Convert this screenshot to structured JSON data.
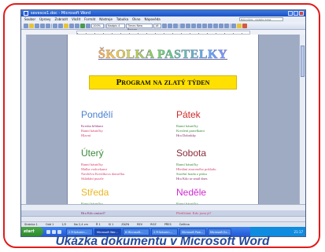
{
  "window": {
    "title": "sevesce1.doc - Microsoft Word"
  },
  "menubar": {
    "items": [
      "Soubor",
      "Úpravy",
      "Zobrazit",
      "Vložit",
      "Formát",
      "Nástroje",
      "Tabulka",
      "Okno",
      "Nápověda"
    ],
    "help_placeholder": "Nápověda - zadejte dotaz"
  },
  "toolbar": {
    "zoom": "100%",
    "style": "Nadpis 4",
    "font": "Times New Roman",
    "size": "16"
  },
  "document": {
    "title": "ŠKOLKA PASTELKY",
    "banner": "Program na zlatý týden",
    "days": [
      {
        "name": "Pondělí",
        "color": "#4a7fd1",
        "items": [
          {
            "text": "Kresba křídami",
            "color": "#8a2d6e"
          },
          {
            "text": "Ranní básničky",
            "color": "#d6406e"
          },
          {
            "text": "Hlavní",
            "color": "#d6406e"
          }
        ]
      },
      {
        "name": "Pátek",
        "color": "#d12a2a",
        "items": [
          {
            "text": "Ranní básničky",
            "color": "#3a8a3a"
          },
          {
            "text": "Kreslení pastelkami",
            "color": "#3a8a3a"
          },
          {
            "text": "Hra Dobrůtky",
            "color": "#8a2d6e"
          }
        ]
      },
      {
        "name": "Úterý",
        "color": "#3a8a3a",
        "items": [
          {
            "text": "Ranní básničky",
            "color": "#d6406e"
          },
          {
            "text": "Malba vodovkami",
            "color": "#d6406e"
          },
          {
            "text": "Navštěva Kreslíkova domečku",
            "color": "#d6406e"
          },
          {
            "text": "Skládání puzzle",
            "color": "#d6406e"
          }
        ]
      },
      {
        "name": "Sobota",
        "color": "#8a2d3a",
        "items": [
          {
            "text": "Ranní básničky",
            "color": "#3a8a3a"
          },
          {
            "text": "Hledání ztraceného pokladu",
            "color": "#d6406e"
          },
          {
            "text": "Stavění hradu z písku",
            "color": "#3a8a3a"
          },
          {
            "text": "Hra Kdo se smál dnes",
            "color": "#8a2d6e"
          }
        ]
      },
      {
        "name": "Středa",
        "color": "#e8b820",
        "items": [
          {
            "text": "Ranní básničky",
            "color": "#3a8a3a"
          },
          {
            "text": "Soutěž s pohárky a kartičkami",
            "color": "#3a8a3a"
          },
          {
            "text": "Hra Kdo zmizel?",
            "color": "#8a2d6e"
          }
        ]
      },
      {
        "name": "Neděle",
        "color": "#d02ad0",
        "items": [
          {
            "text": "Ranní básničky",
            "color": "#3a8a3a"
          },
          {
            "text": "Hra Co je to?",
            "color": "#d6406e"
          },
          {
            "text": "Předčítání: Kdo jsem já?",
            "color": "#d6406e"
          }
        ]
      }
    ]
  },
  "statusbar": [
    "Stránka 1",
    "Odd 1",
    "1/3",
    "Na 2,4 cm",
    "Ř 1",
    "Sl 1",
    "ZÁZN",
    "REV",
    "ROZ",
    "PŘES",
    "Čeština"
  ],
  "taskbar": {
    "start": "start",
    "tasks": [
      "2 Průzkumn...",
      "Microsoft Wor...",
      "6 Microsoft...",
      "2 Průzkumn...",
      "Microsoft Pow...",
      "Microsoft Ex..."
    ],
    "clock": "21:17"
  },
  "caption": "Ukázka dokumentu v Microsoft Word"
}
